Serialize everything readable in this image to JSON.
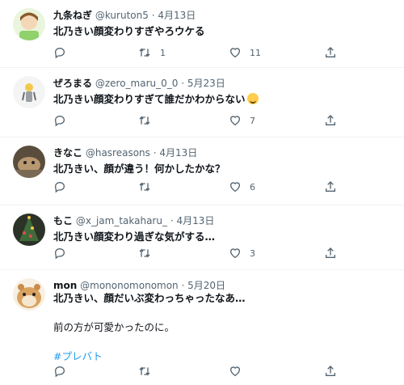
{
  "tweets": [
    {
      "display_name": "九条ねぎ",
      "handle": "@kuruton5",
      "date": "4月13日",
      "lines": [
        "北乃きい顔変わりすぎやろウケる"
      ],
      "retweets": "1",
      "likes": "11",
      "avatar_color": "#8fd16a"
    },
    {
      "display_name": "ぜろまる",
      "handle": "@zero_maru_0_0",
      "date": "5月23日",
      "lines": [
        "北乃きい顔変わりすぎて誰だかわからない"
      ],
      "emoji": "sweat-smile-emoji",
      "retweets": "",
      "likes": "7",
      "avatar_color": "#f2f2f2"
    },
    {
      "display_name": "きなこ",
      "handle": "@hasreasons",
      "date": "4月13日",
      "lines": [
        "北乃きい、顔が違う！何かしたかな？"
      ],
      "retweets": "",
      "likes": "6",
      "avatar_color": "#7a6a55"
    },
    {
      "display_name": "もこ",
      "handle": "@x_jam_takaharu_",
      "date": "4月13日",
      "lines": [
        "北乃きい顔変わり過ぎな気がする…"
      ],
      "retweets": "",
      "likes": "3",
      "avatar_color": "#3d4a3a"
    },
    {
      "display_name": "mon",
      "handle": "@mononomonomon",
      "date": "5月20日",
      "lines": [
        "北乃きい、顔だいぶ変わっちゃったなあ…",
        "",
        "前の方が可愛かったのに。"
      ],
      "hashtag": "#プレバト",
      "retweets": "",
      "likes": "",
      "avatar_color": "#d9a25f"
    }
  ],
  "colors": {
    "text": "#0f1419",
    "meta": "#536471",
    "link": "#1d9bf0",
    "divider": "#eff3f4"
  }
}
